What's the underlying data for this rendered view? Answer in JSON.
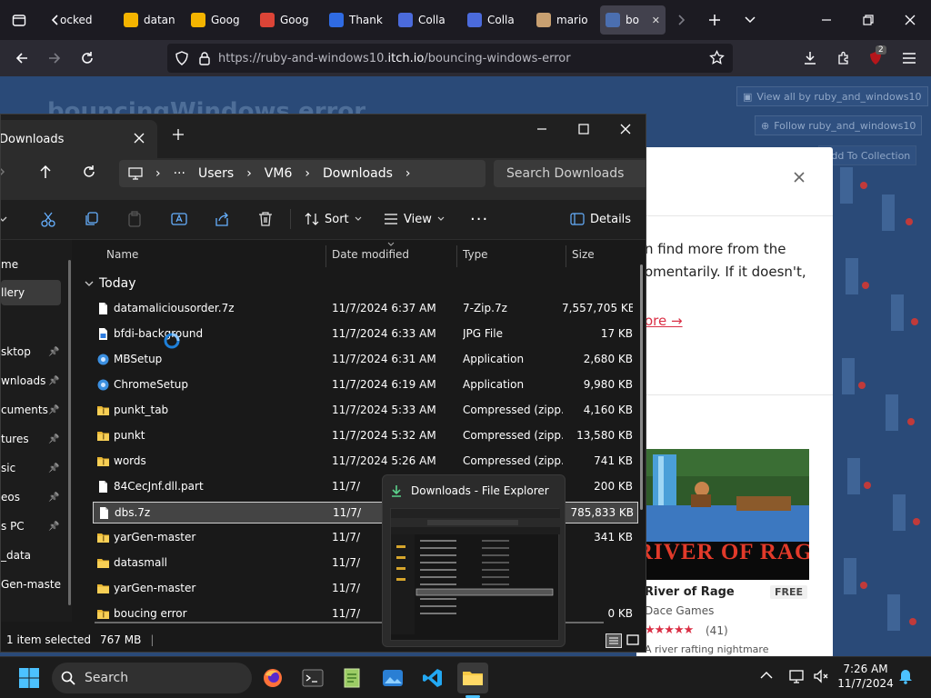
{
  "browser": {
    "tabs": [
      {
        "label": "ocked",
        "icon": "lock-page-icon"
      },
      {
        "label": "datan",
        "icon": "google-drive-icon"
      },
      {
        "label": "Goog",
        "icon": "google-drive-icon"
      },
      {
        "label": "Goog",
        "icon": "chrome-icon"
      },
      {
        "label": "Thank",
        "icon": "meta-icon"
      },
      {
        "label": "Colla",
        "icon": "colab-icon"
      },
      {
        "label": "Colla",
        "icon": "colab-icon"
      },
      {
        "label": "mario",
        "icon": "page-icon"
      },
      {
        "label": "bo",
        "icon": "itch-icon",
        "active": true
      }
    ],
    "url_prefix": "https://ruby-and-windows10.",
    "url_host": "itch.io",
    "url_path": "/bouncing-windows-error",
    "extension_badge": "2"
  },
  "itch_page": {
    "title": "bouncingWindows error",
    "buttons": [
      "View all by ruby_and_windows10",
      "Follow ruby_and_windows10",
      "Add To Collection"
    ],
    "modal": {
      "text_lines": [
        "n find more from the",
        "omentarily. If it doesn't,"
      ],
      "link": "ore →",
      "game_banner_text": "RIVER OF RAGE",
      "game_title": "River of Rage",
      "game_price": "FREE",
      "game_author": "Dace Games",
      "rating_count": "(41)",
      "game_desc": "A river rafting nightmare"
    }
  },
  "explorer": {
    "tab_title": "Downloads",
    "breadcrumbs": [
      "Users",
      "VM6",
      "Downloads"
    ],
    "search_placeholder": "Search Downloads",
    "commands": {
      "sort": "Sort",
      "view": "View",
      "details": "Details"
    },
    "sidebar": [
      {
        "label": "me",
        "pinned": false
      },
      {
        "label": "llery",
        "pinned": false,
        "selected": true
      },
      {
        "label": "sktop",
        "pinned": true
      },
      {
        "label": "wnloads",
        "pinned": true
      },
      {
        "label": "cuments",
        "pinned": true
      },
      {
        "label": "tures",
        "pinned": true
      },
      {
        "label": "sic",
        "pinned": true
      },
      {
        "label": "eos",
        "pinned": true
      },
      {
        "label": "s PC",
        "pinned": true
      },
      {
        "label": "_data",
        "pinned": false
      },
      {
        "label": "Gen-master",
        "pinned": false
      }
    ],
    "columns": {
      "name": "Name",
      "date": "Date modified",
      "type": "Type",
      "size": "Size"
    },
    "group": "Today",
    "files": [
      {
        "name": "datamaliciousorder.7z",
        "date": "11/7/2024 6:37 AM",
        "type": "7-Zip.7z",
        "size": "7,557,705 KB",
        "icon": "archive"
      },
      {
        "name": "bfdi-background",
        "date": "11/7/2024 6:33 AM",
        "type": "JPG File",
        "size": "17 KB",
        "icon": "image"
      },
      {
        "name": "MBSetup",
        "date": "11/7/2024 6:31 AM",
        "type": "Application",
        "size": "2,680 KB",
        "icon": "app"
      },
      {
        "name": "ChromeSetup",
        "date": "11/7/2024 6:19 AM",
        "type": "Application",
        "size": "9,980 KB",
        "icon": "app"
      },
      {
        "name": "punkt_tab",
        "date": "11/7/2024 5:33 AM",
        "type": "Compressed (zipp...",
        "size": "4,160 KB",
        "icon": "zip"
      },
      {
        "name": "punkt",
        "date": "11/7/2024 5:32 AM",
        "type": "Compressed (zipp...",
        "size": "13,580 KB",
        "icon": "zip"
      },
      {
        "name": "words",
        "date": "11/7/2024 5:26 AM",
        "type": "Compressed (zipp...",
        "size": "741 KB",
        "icon": "zip"
      },
      {
        "name": "84CecJnf.dll.part",
        "date": "11/7/",
        "type": "",
        "size": "200 KB",
        "icon": "file"
      },
      {
        "name": "dbs.7z",
        "date": "11/7/",
        "type": "",
        "size": "785,833 KB",
        "icon": "file",
        "selected": true
      },
      {
        "name": "yarGen-master",
        "date": "11/7/",
        "type": "",
        "size": "341 KB",
        "icon": "zip"
      },
      {
        "name": "datasmall",
        "date": "11/7/",
        "type": "",
        "size": "",
        "icon": "folder"
      },
      {
        "name": "yarGen-master",
        "date": "11/7/",
        "type": "",
        "size": "",
        "icon": "folder"
      },
      {
        "name": "boucing error",
        "date": "11/7/",
        "type": "",
        "size": "0 KB",
        "icon": "zip"
      }
    ],
    "status_selected": "1 item selected",
    "status_size": "767 MB"
  },
  "preview": {
    "title": "Downloads - File Explorer"
  },
  "taskbar": {
    "search": "Search",
    "time": "7:26 AM",
    "date": "11/7/2024"
  }
}
